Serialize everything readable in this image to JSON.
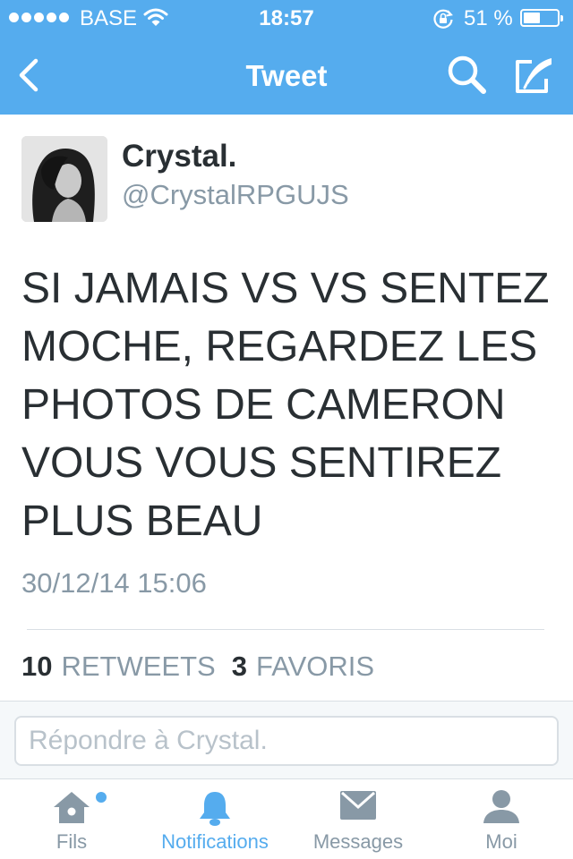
{
  "status_bar": {
    "carrier": "BASE",
    "time": "18:57",
    "battery": "51 %",
    "battery_level": 0.51
  },
  "nav": {
    "title": "Tweet",
    "icons": [
      "back-icon",
      "search-icon",
      "compose-icon"
    ]
  },
  "tweet": {
    "display_name": "Crystal.",
    "handle": "@CrystalRPGUJS",
    "text": "SI JAMAIS VS VS SENTEZ\nMOCHE, REGARDEZ LES\nPHOTOS DE CAMERON\nVOUS VOUS SENTIREZ\nPLUS BEAU",
    "timestamp": "30/12/14 15:06",
    "retweets_count": "10",
    "retweets_label": "RETWEETS",
    "favorites_count": "3",
    "favorites_label": "FAVORIS"
  },
  "reply": {
    "placeholder": "Répondre à Crystal."
  },
  "tab_bar": {
    "tabs": [
      {
        "label": "Fils",
        "icon": "home-icon",
        "active": false,
        "unread": true
      },
      {
        "label": "Notifications",
        "icon": "bell-icon",
        "active": true
      },
      {
        "label": "Messages",
        "icon": "envelope-icon",
        "active": false
      },
      {
        "label": "Moi",
        "icon": "person-icon",
        "active": false
      }
    ]
  },
  "colors": {
    "accent": "#55acee",
    "text": "#292f33",
    "muted": "#8899a6"
  }
}
